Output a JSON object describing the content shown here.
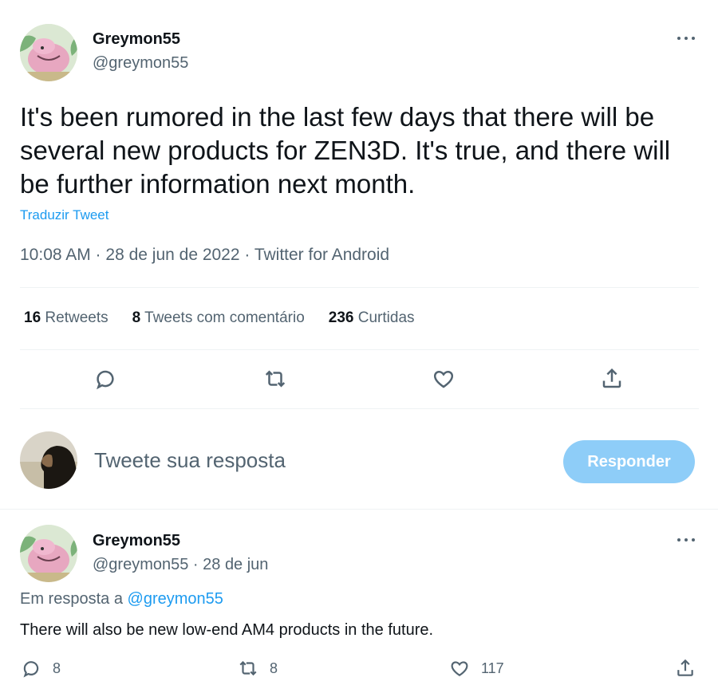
{
  "tweet": {
    "author_name": "Greymon55",
    "author_handle": "@greymon55",
    "text": "It's been rumored in the last few days that there will be several new products for ZEN3D. It's true, and there will be further information next month.",
    "translate_label": "Traduzir Tweet",
    "meta": "10:08 AM · 28 de jun de 2022 · Twitter for Android",
    "stats": {
      "retweets_count": "16",
      "retweets_label": "Retweets",
      "quotes_count": "8",
      "quotes_label": "Tweets com comentário",
      "likes_count": "236",
      "likes_label": "Curtidas"
    }
  },
  "compose": {
    "placeholder": "Tweete sua resposta",
    "button_label": "Responder"
  },
  "reply": {
    "author_name": "Greymon55",
    "author_handle_date": "@greymon55 · 28 de jun",
    "reply_to_prefix": "Em resposta a",
    "reply_to_handle": "@greymon55",
    "text": "There will also be new low-end AM4 products in the future.",
    "counts": {
      "replies": "8",
      "retweets": "8",
      "likes": "117"
    }
  },
  "colors": {
    "accent": "#1d9bf0",
    "button_disabled": "#8ecdf8",
    "secondary_text": "#536471",
    "divider": "#eff3f4"
  }
}
